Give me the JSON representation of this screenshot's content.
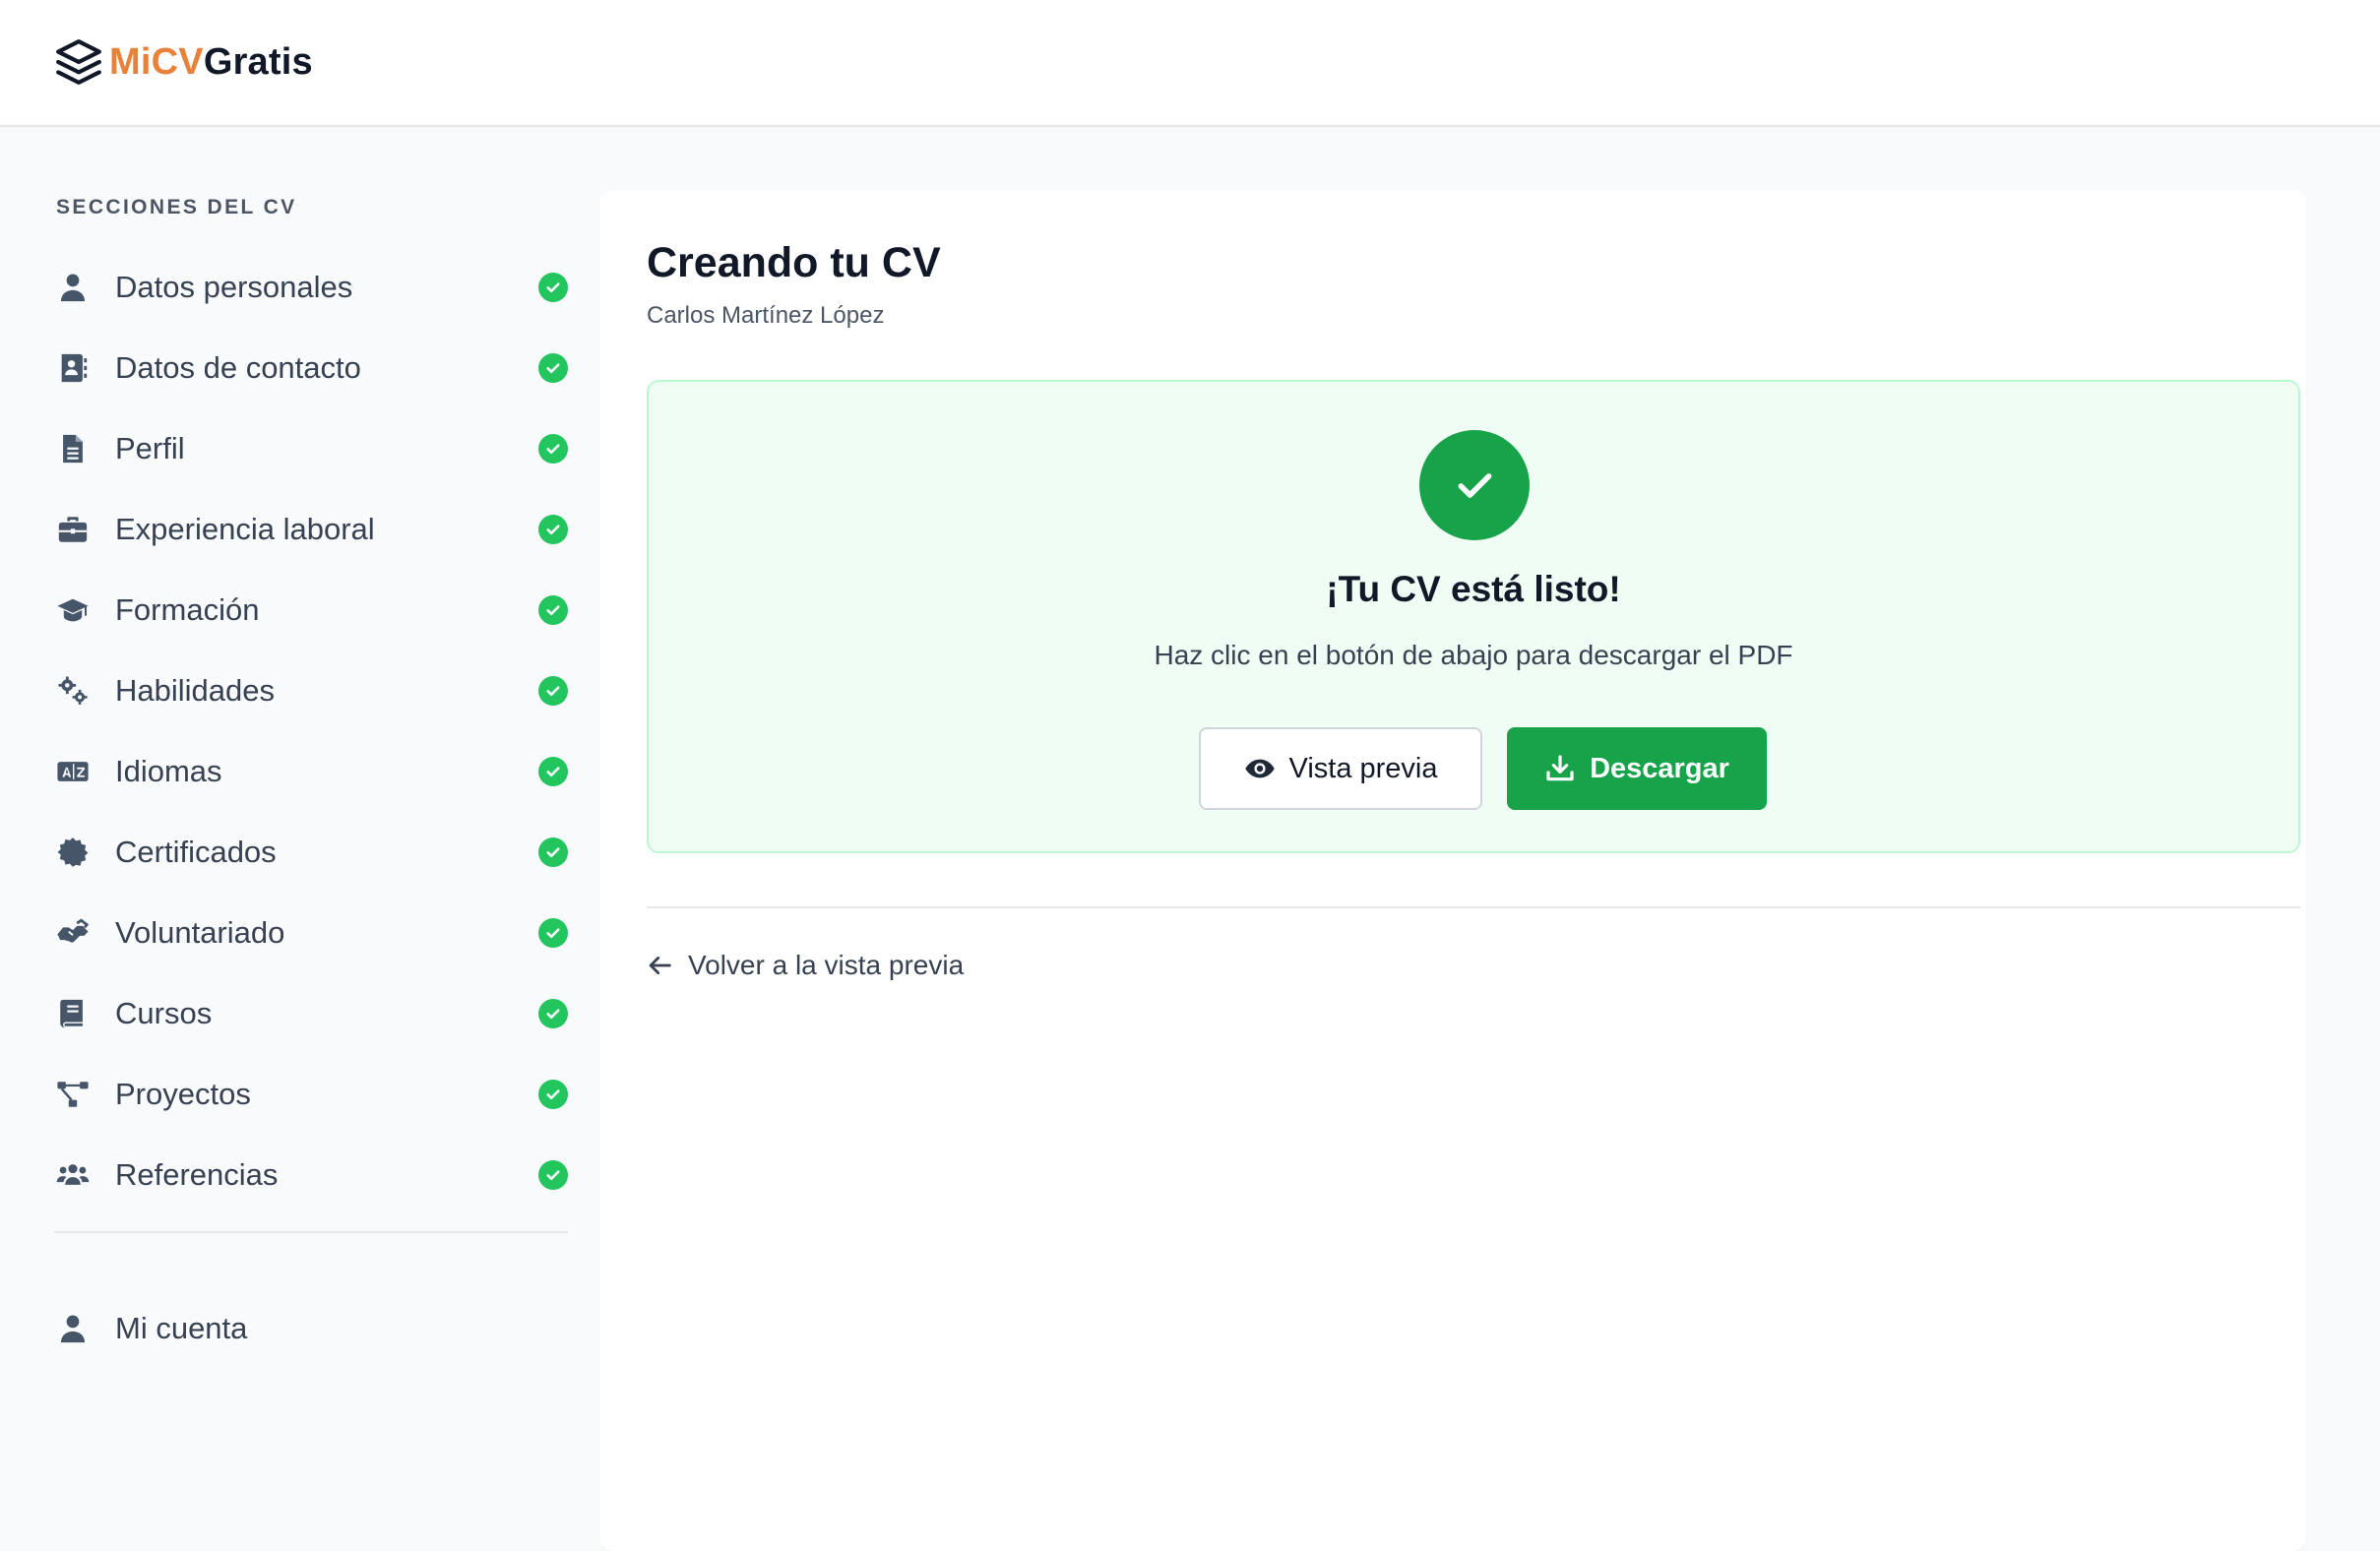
{
  "brand": {
    "part1": "MiCV",
    "part2": "Gratis"
  },
  "sidebar": {
    "heading": "SECCIONES DEL CV",
    "items": [
      {
        "label": "Datos personales",
        "icon": "user-icon",
        "completed": true
      },
      {
        "label": "Datos de contacto",
        "icon": "address-book-icon",
        "completed": true
      },
      {
        "label": "Perfil",
        "icon": "document-icon",
        "completed": true
      },
      {
        "label": "Experiencia laboral",
        "icon": "briefcase-icon",
        "completed": true
      },
      {
        "label": "Formación",
        "icon": "graduation-cap-icon",
        "completed": true
      },
      {
        "label": "Habilidades",
        "icon": "gears-icon",
        "completed": true
      },
      {
        "label": "Idiomas",
        "icon": "language-icon",
        "completed": true
      },
      {
        "label": "Certificados",
        "icon": "certificate-icon",
        "completed": true
      },
      {
        "label": "Voluntariado",
        "icon": "handshake-icon",
        "completed": true
      },
      {
        "label": "Cursos",
        "icon": "book-icon",
        "completed": true
      },
      {
        "label": "Proyectos",
        "icon": "diagram-icon",
        "completed": true
      },
      {
        "label": "Referencias",
        "icon": "users-icon",
        "completed": true
      }
    ],
    "account": {
      "label": "Mi cuenta",
      "icon": "user-icon"
    }
  },
  "main": {
    "title": "Creando tu CV",
    "subtitle": "Carlos Martínez López",
    "success": {
      "title": "¡Tu CV está listo!",
      "message": "Haz clic en el botón de abajo para descargar el PDF",
      "preview_button": "Vista previa",
      "download_button": "Descargar"
    },
    "back_link": "Volver a la vista previa"
  },
  "colors": {
    "brand_accent": "#e8823a",
    "success_green": "#16a34a",
    "check_green": "#22c55e",
    "success_bg": "#f0fdf4"
  }
}
